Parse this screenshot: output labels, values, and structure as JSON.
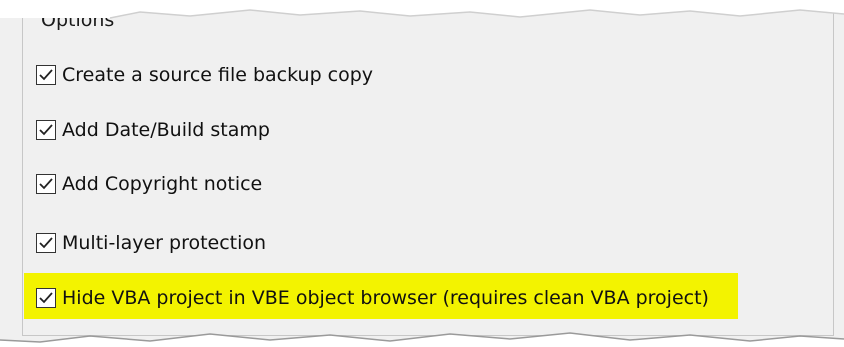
{
  "group": {
    "title": "Options"
  },
  "options": [
    {
      "label": "Create a source file backup copy",
      "checked": true
    },
    {
      "label": "Add Date/Build stamp",
      "checked": true
    },
    {
      "label": "Add Copyright notice",
      "checked": true
    },
    {
      "label": "Multi-layer protection",
      "checked": true
    },
    {
      "label": "Hide VBA project in VBE object browser (requires clean VBA project)",
      "checked": true,
      "highlighted": true
    }
  ],
  "colors": {
    "highlight": "#f3f300",
    "panel_background": "#f0f0f0"
  }
}
